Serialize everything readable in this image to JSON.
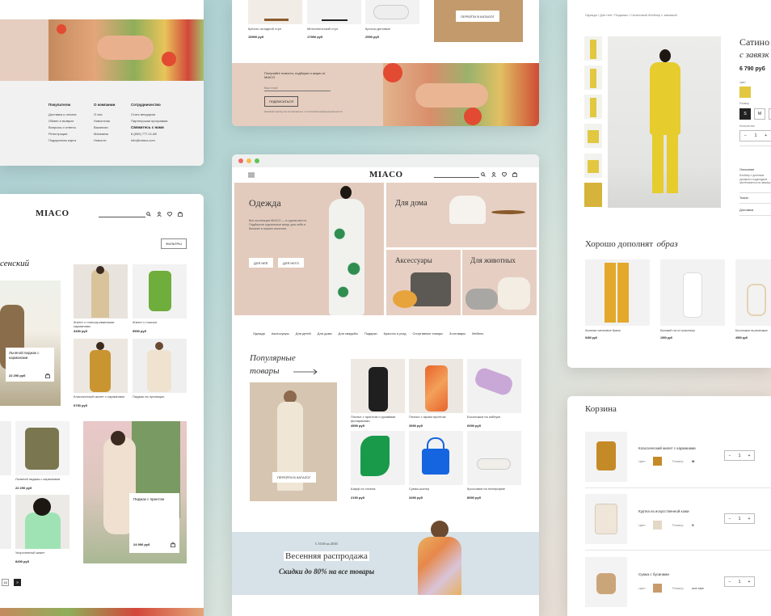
{
  "brand": "MIACO",
  "colors": {
    "accent": "#d8c1b3",
    "banner": "#d6e2e7",
    "yellow": "#e2c840",
    "mustard": "#c58a28"
  },
  "footer": {
    "col1": {
      "title": "Покупателю",
      "items": [
        "Доставка и оплата",
        "Обмен и возврат",
        "Вопросы и ответы",
        "Регистрация",
        "Подарочная карта"
      ]
    },
    "col2": {
      "title": "О компании",
      "items": [
        "О нас",
        "Новостная",
        "Вакансии",
        "Магазины",
        "Новости"
      ]
    },
    "col3": {
      "title": "Сотрудничество",
      "items": [
        "Стать вендором",
        "Партнерская программа"
      ],
      "contact_title": "Свяжитесь с нами",
      "phone": "8 (800) 777-11-88",
      "email": "info@miaco.com"
    }
  },
  "catalog": {
    "filters": "ФИЛЬТРЫ",
    "heading": "сенский",
    "items": [
      {
        "caption": "Жилет с плиссированными карманами",
        "price": "3490 руб"
      },
      {
        "caption": "Жилет с поясом",
        "price": "5590 руб"
      },
      {
        "caption": "Классический жилет с карманами",
        "price": "6790 руб"
      },
      {
        "caption": "Пиджак на пуговицах",
        "price": "6490 руб"
      },
      {
        "caption": "Льняной пиджак с карманами",
        "price": "22 290 руб"
      },
      {
        "caption": "Укороченный жакет",
        "price": "8490 руб"
      }
    ],
    "card1": {
      "title": "Льняной пиджак с карманами",
      "price": "22 290 руб"
    },
    "card2": {
      "title": "Пиджак с принтом",
      "price": "24 990 руб"
    },
    "pages": [
      "18",
      "»"
    ]
  },
  "top_mid": {
    "items": [
      {
        "caption": "Кресло складной стул",
        "price": "15990 руб"
      },
      {
        "caption": "Металлический стул",
        "price": "17990 руб"
      },
      {
        "caption": "Кроссы деловые",
        "price": "2590 руб"
      }
    ],
    "cta": "ПЕРЕЙТИ В КАТАЛОГ",
    "newsletter_text": "Получайте новости, подборки и акции от MIACO",
    "newsletter_placeholder": "Ваш email",
    "subscribe": "ПОДПИСАТЬСЯ",
    "consent": "Нажимая кнопку, вы соглашаетесь с политикой конфиденциальности"
  },
  "main": {
    "hero_title": "Одежда",
    "hero_text": "Все коллекции MIACO — в одном месте. Подберите идеальные вещи для себя и близких в нашем каталоге.",
    "btn_her": "ДЛЯ НЕЁ",
    "btn_him": "ДЛЯ НЕГО",
    "tile_home": "Для дома",
    "tile_acc": "Аксессуары",
    "tile_pets": "Для животных",
    "nav": [
      "Одежда",
      "Аксессуары",
      "Для детей",
      "Для дома",
      "Для свадьбы",
      "Подарки",
      "Красота и уход",
      "Спортивные товары",
      "Зоотовары",
      "Мебель"
    ],
    "popular_title_1": "Популярные",
    "popular_title_2": "товары",
    "catalog_btn": "ПЕРЕЙТИ В КАТАЛОГ",
    "products": [
      {
        "caption": "Платье с принтом и рукавами фонариками",
        "price": "4590 руб"
      },
      {
        "caption": "Платье с ярким принтом",
        "price": "3990 руб"
      },
      {
        "caption": "Босоножки на каблуке",
        "price": "6990 руб"
      },
      {
        "caption": "Шарф из хлопка",
        "price": "2190 руб"
      },
      {
        "caption": "Сумка-шопер",
        "price": "3490 руб"
      },
      {
        "caption": "Кроссовки на платформе",
        "price": "8990 руб"
      }
    ],
    "sale_small": "С 10.03 по 20.03",
    "sale_title": "Весенняя распродажа",
    "sale_sub": "Скидки до 80% на все товары"
  },
  "product": {
    "breadcrumb": "Одежда / Для неё / Пиджаки / Сатиновый блейзер с завязкой",
    "title_1": "Сатино",
    "title_2": "с завязк",
    "price": "6 790 руб",
    "color_label": "Цвет",
    "size_label": "Размер",
    "sizes": [
      "S",
      "M"
    ],
    "qty_label": "Количество",
    "qty": "1",
    "desc_label": "Описание",
    "desc_text": "Блейзер с длинным рукавом и подкладкой, застёгивается на завязку",
    "fabric_label": "Ткани",
    "delivery_label": "Доставка",
    "complete_1": "Хорошо дополнят",
    "complete_2": "образ",
    "complete_items": [
      {
        "caption": "Льняные сатиновые брюки",
        "price": "5490 руб"
      },
      {
        "caption": "Базовый топ из трикотажа",
        "price": "1990 руб"
      },
      {
        "caption": "Босоножки на ремешках",
        "price": "4590 руб"
      }
    ]
  },
  "cart": {
    "title": "Корзина",
    "color_label": "Цвет",
    "size_label": "Размер",
    "items": [
      {
        "name": "Классический жилет с карманами",
        "size": "M",
        "qty": "1"
      },
      {
        "name": "Куртка из искусственной кожи",
        "size": "S",
        "qty": "1"
      },
      {
        "name": "Сумка с бусинами",
        "size": "one size",
        "qty": "1"
      }
    ]
  }
}
